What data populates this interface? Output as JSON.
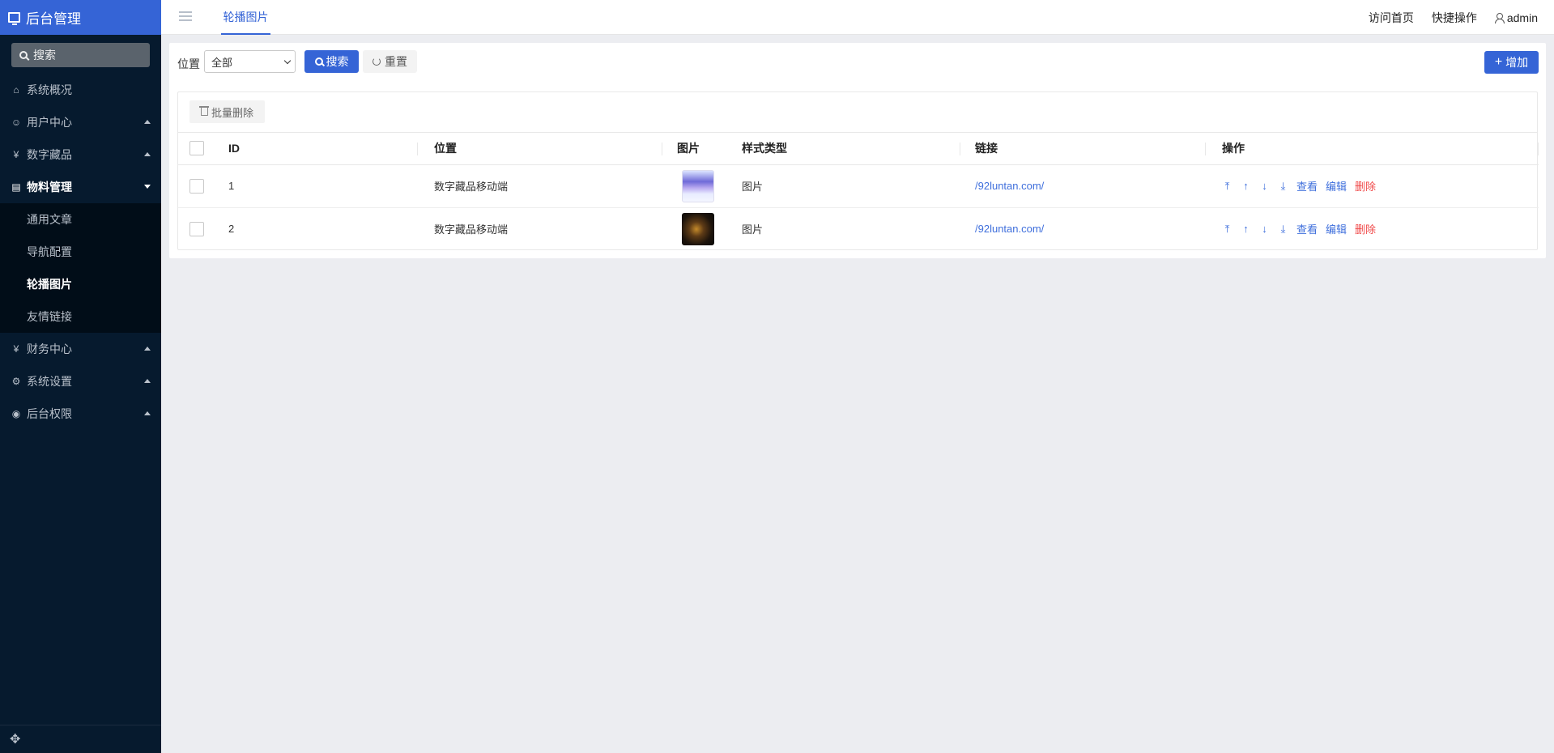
{
  "app": {
    "title": "后台管理"
  },
  "sidebar": {
    "search_label": "搜索",
    "items": [
      {
        "label": "系统概况",
        "icon": "home-icon"
      },
      {
        "label": "用户中心",
        "icon": "users-icon"
      },
      {
        "label": "数字藏品",
        "icon": "yen-icon"
      },
      {
        "label": "物料管理",
        "icon": "list-icon"
      },
      {
        "label": "财务中心",
        "icon": "yen-icon"
      },
      {
        "label": "系统设置",
        "icon": "gear-icon"
      },
      {
        "label": "后台权限",
        "icon": "user-circle-icon"
      }
    ],
    "subitems": [
      {
        "label": "通用文章"
      },
      {
        "label": "导航配置"
      },
      {
        "label": "轮播图片"
      },
      {
        "label": "友情链接"
      }
    ]
  },
  "topbar": {
    "tab_label": "轮播图片",
    "links": [
      "访问首页",
      "快捷操作"
    ],
    "user": "admin"
  },
  "filter": {
    "position_label": "位置",
    "select_value": "全部",
    "search_label": "搜索",
    "reset_label": "重置",
    "add_label": "增加"
  },
  "table": {
    "batch_delete_label": "批量删除",
    "headers": [
      "ID",
      "位置",
      "图片",
      "样式类型",
      "链接",
      "操作"
    ],
    "rows": [
      {
        "id": "1",
        "position": "数字藏品移动端",
        "style": "图片",
        "link": "/92luntan.com/"
      },
      {
        "id": "2",
        "position": "数字藏品移动端",
        "style": "图片",
        "link": "/92luntan.com/"
      }
    ],
    "actions": {
      "view": "查看",
      "edit": "编辑",
      "delete": "删除"
    }
  },
  "colors": {
    "accent": "#3564d6",
    "sidebar_bg": "#061a2e",
    "danger": "#f04848",
    "link": "#3f6fdc"
  }
}
